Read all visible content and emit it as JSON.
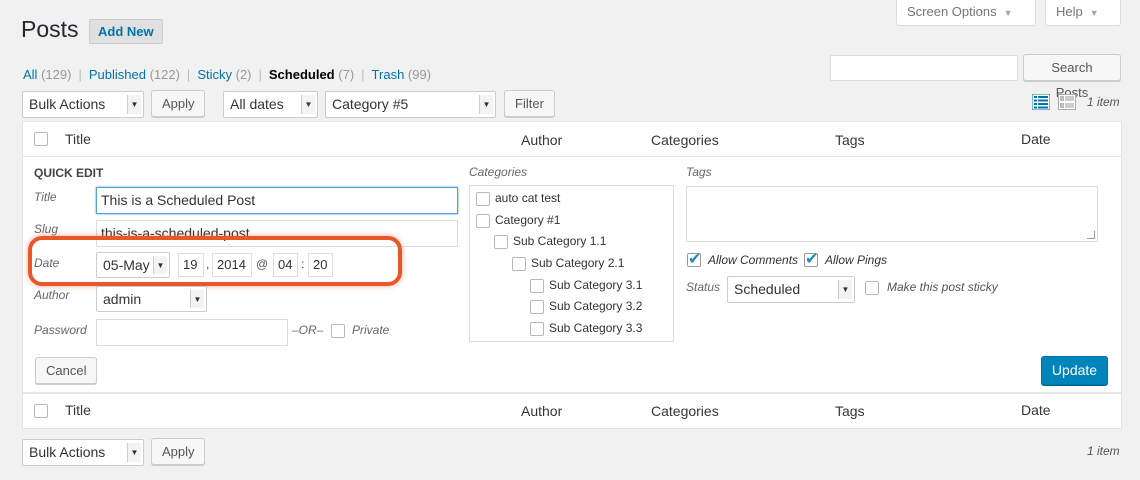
{
  "screen_options": {
    "label": "Screen Options",
    "icon": "caret-down-icon"
  },
  "help": {
    "label": "Help",
    "icon": "caret-down-icon"
  },
  "page": {
    "title": "Posts",
    "add_new": "Add New"
  },
  "filters": {
    "all": "All",
    "all_count": "(129)",
    "published": "Published",
    "published_count": "(122)",
    "sticky": "Sticky",
    "sticky_count": "(2)",
    "scheduled": "Scheduled",
    "scheduled_count": "(7)",
    "trash": "Trash",
    "trash_count": "(99)",
    "separator": "|"
  },
  "search": {
    "button": "Search Posts",
    "value": ""
  },
  "tablenav_top": {
    "bulk_actions": "Bulk Actions",
    "apply": "Apply",
    "dates": "All dates",
    "category": "Category #5",
    "filter": "Filter",
    "count": "1 item"
  },
  "tablenav_bottom": {
    "bulk_actions": "Bulk Actions",
    "apply": "Apply",
    "count": "1 item"
  },
  "columns": {
    "title": "Title",
    "author": "Author",
    "categories": "Categories",
    "tags": "Tags",
    "date": "Date"
  },
  "quick_edit": {
    "heading": "QUICK EDIT",
    "title_label": "Title",
    "title_value": "This is a Scheduled Post",
    "slug_label": "Slug",
    "slug_value": "this-is-a-scheduled-post",
    "date_label": "Date",
    "month": "05-May",
    "day": "19",
    "comma": ",",
    "year": "2014",
    "at": "@",
    "hour": "04",
    "colon": ":",
    "minute": "20",
    "author_label": "Author",
    "author_value": "admin",
    "password_label": "Password",
    "password_value": "",
    "or": "–OR–",
    "private_label": "Private",
    "categories_label": "Categories",
    "categories": [
      "auto cat test",
      "Category #1",
      "Sub Category 1.1",
      "Sub Category 2.1",
      "Sub Category 3.1",
      "Sub Category 3.2",
      "Sub Category 3.3"
    ],
    "tags_label": "Tags",
    "tags_value": "",
    "allow_comments": "Allow Comments",
    "allow_pings": "Allow Pings",
    "status_label": "Status",
    "status_value": "Scheduled",
    "sticky_label": "Make this post sticky",
    "cancel": "Cancel",
    "update": "Update"
  },
  "colors": {
    "primary": "#0085ba",
    "highlight": "#e8572a",
    "link": "#0073aa"
  }
}
